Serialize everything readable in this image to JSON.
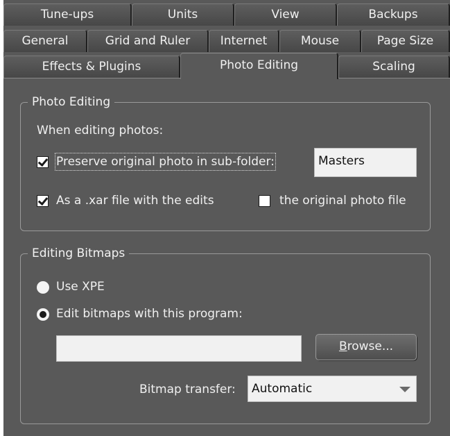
{
  "tabs": {
    "row1": [
      "Tune-ups",
      "Units",
      "View",
      "Backups"
    ],
    "row2": [
      "General",
      "Grid and Ruler",
      "Internet",
      "Mouse",
      "Page Size"
    ],
    "row3": [
      "Effects & Plugins",
      "Photo Editing",
      "Scaling"
    ],
    "active": "Photo Editing"
  },
  "photo_editing": {
    "title": "Photo Editing",
    "intro": "When editing photos:",
    "preserve_label": "Preserve original photo in sub-folder:",
    "preserve_checked": true,
    "subfolder_value": "Masters",
    "xar_label": "As a .xar file with the edits",
    "xar_checked": true,
    "original_label": "the original photo file",
    "original_checked": false
  },
  "editing_bitmaps": {
    "title": "Editing Bitmaps",
    "use_xpe_label": "Use XPE",
    "edit_with_program_label": "Edit bitmaps with this program:",
    "selected": "edit_with_program",
    "program_path": "",
    "browse_underlined": "B",
    "browse_rest": "rowse...",
    "transfer_label": "Bitmap transfer:",
    "transfer_value": "Automatic"
  }
}
